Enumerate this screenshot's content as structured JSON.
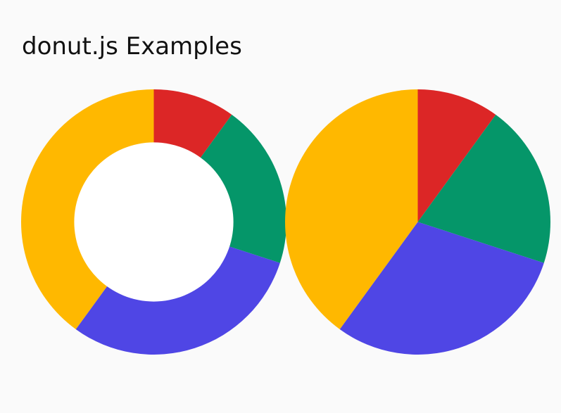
{
  "page": {
    "title": "donut.js Examples"
  },
  "chart_data": [
    {
      "type": "pie",
      "variant": "donut",
      "inner_radius_ratio": 0.6,
      "start_angle_deg": 0,
      "direction": "clockwise",
      "values": [
        10,
        20,
        30,
        40
      ],
      "colors": [
        "#dc2626",
        "#059669",
        "#4f46e5",
        "#ffb800"
      ],
      "hole_color": "#ffffff"
    },
    {
      "type": "pie",
      "variant": "pie",
      "inner_radius_ratio": 0,
      "start_angle_deg": 0,
      "direction": "clockwise",
      "values": [
        10,
        20,
        30,
        40
      ],
      "colors": [
        "#dc2626",
        "#059669",
        "#4f46e5",
        "#ffb800"
      ]
    }
  ]
}
